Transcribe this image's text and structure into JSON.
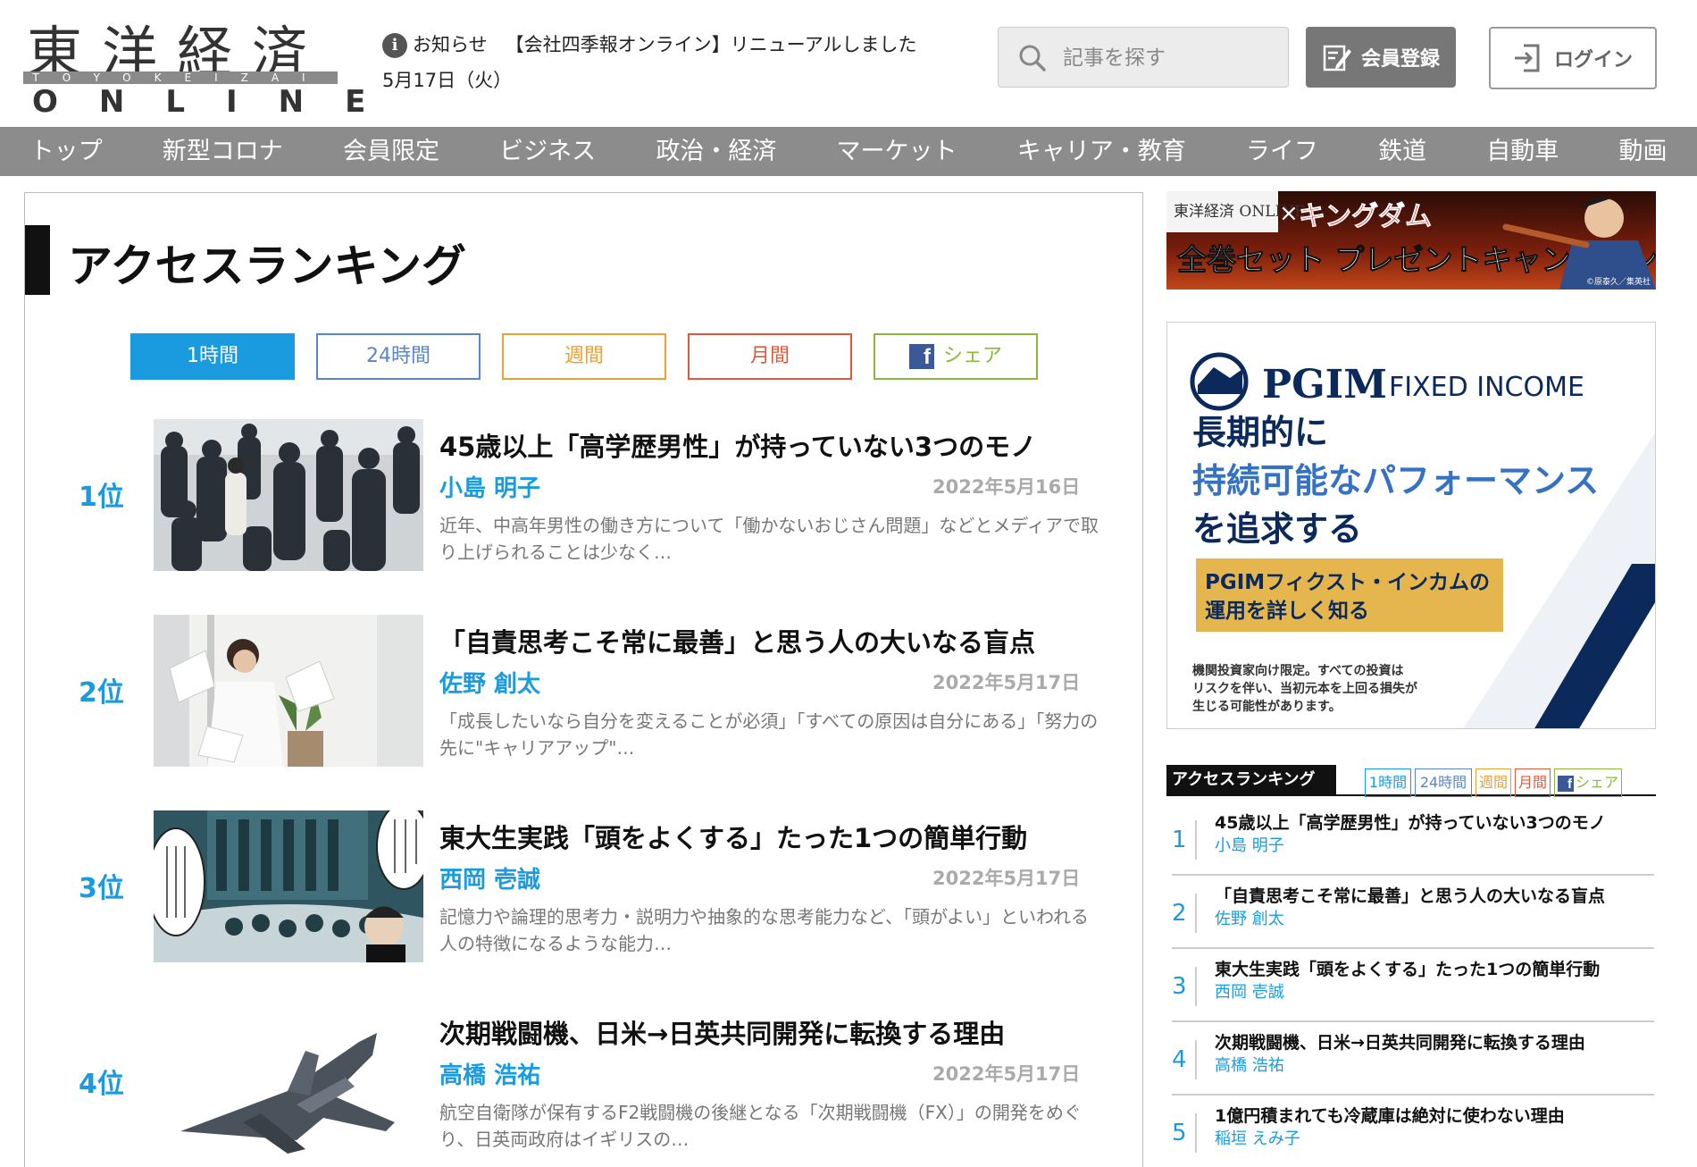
{
  "header": {
    "logo_main": "東洋経済",
    "logo_bar": "TOYOKEIZAI",
    "logo_sub": "ONLINE",
    "notice_label": "お知らせ",
    "notice_text": "【会社四季報オンライン】リニューアルしました",
    "date": "5月17日（火）",
    "search_placeholder": "記事を探す",
    "register_label": "会員登録",
    "login_label": "ログイン"
  },
  "nav": [
    "トップ",
    "新型コロナ",
    "会員限定",
    "ビジネス",
    "政治・経済",
    "マーケット",
    "キャリア・教育",
    "ライフ",
    "鉄道",
    "自動車",
    "動画"
  ],
  "ranking": {
    "heading": "アクセスランキング",
    "tabs": [
      {
        "label": "1時間",
        "color": "#1a9be0"
      },
      {
        "label": "24時間",
        "color": "#5a86c5"
      },
      {
        "label": "週間",
        "color": "#e9a035"
      },
      {
        "label": "月間",
        "color": "#e0583a"
      },
      {
        "label": "シェア",
        "color": "#8ab83a"
      }
    ],
    "articles": [
      {
        "rank": "1位",
        "title": "45歳以上「高学歴男性」が持っていない3つのモノ",
        "author": "小島 明子",
        "date": "2022年5月16日",
        "excerpt": "近年、中高年男性の働き方について「働かないおじさん問題」などとメディアで取り上げられることは少なく…"
      },
      {
        "rank": "2位",
        "title": "「自責思考こそ常に最善」と思う人の大いなる盲点",
        "author": "佐野 創太",
        "date": "2022年5月17日",
        "excerpt": "「成長したいなら自分を変えることが必須」「すべての原因は自分にある」「努力の先に\"キャリアアップ\"…"
      },
      {
        "rank": "3位",
        "title": "東大生実践「頭をよくする」たった1つの簡単行動",
        "author": "西岡 壱誠",
        "date": "2022年5月17日",
        "excerpt": "記憶力や論理的思考力・説明力や抽象的な思考能力など、「頭がよい」といわれる人の特徴になるような能力…"
      },
      {
        "rank": "4位",
        "title": "次期戦闘機、日米→日英共同開発に転換する理由",
        "author": "高橋 浩祐",
        "date": "2022年5月17日",
        "excerpt": "航空自衛隊が保有するF2戦闘機の後継となる「次期戦闘機（FX）」の開発をめぐり、日英両政府はイギリスの…"
      }
    ]
  },
  "ads": {
    "kingdom": {
      "logo": "東洋経済 ONLINE",
      "times": "×",
      "title": "キングダム",
      "headline": "全巻セット プレゼントキャンペーン",
      "credit": "©原泰久／集英社"
    },
    "pgim": {
      "brand": "PGIM",
      "brand_sub": "FIXED INCOME",
      "line1": "長期的に",
      "line2": "持続可能なパフォーマンス",
      "line3": "を追求する",
      "cta_line1": "PGIMフィクスト・インカムの",
      "cta_line2": "運用を詳しく知る",
      "disclaimer_line1": "機関投資家向け限定。すべての投資は",
      "disclaimer_line2": "リスクを伴い、当初元本を上回る損失が",
      "disclaimer_line3": "生じる可能性があります。"
    }
  },
  "sidebar_ranking": {
    "label": "アクセスランキング",
    "tabs": [
      {
        "label": "1時間",
        "color": "#1a9be0"
      },
      {
        "label": "24時間",
        "color": "#5a86c5"
      },
      {
        "label": "週間",
        "color": "#e9a035"
      },
      {
        "label": "月間",
        "color": "#e0583a"
      },
      {
        "label": "シェア",
        "color": "#8ab83a"
      }
    ],
    "items": [
      {
        "rank": "1",
        "title": "45歳以上「高学歴男性」が持っていない3つのモノ",
        "author": "小島 明子"
      },
      {
        "rank": "2",
        "title": "「自責思考こそ常に最善」と思う人の大いなる盲点",
        "author": "佐野 創太"
      },
      {
        "rank": "3",
        "title": "東大生実践「頭をよくする」たった1つの簡単行動",
        "author": "西岡 壱誠"
      },
      {
        "rank": "4",
        "title": "次期戦闘機、日米→日英共同開発に転換する理由",
        "author": "高橋 浩祐"
      },
      {
        "rank": "5",
        "title": "1億円積まれても冷蔵庫は絶対に使わない理由",
        "author": "稲垣 えみ子"
      }
    ]
  }
}
